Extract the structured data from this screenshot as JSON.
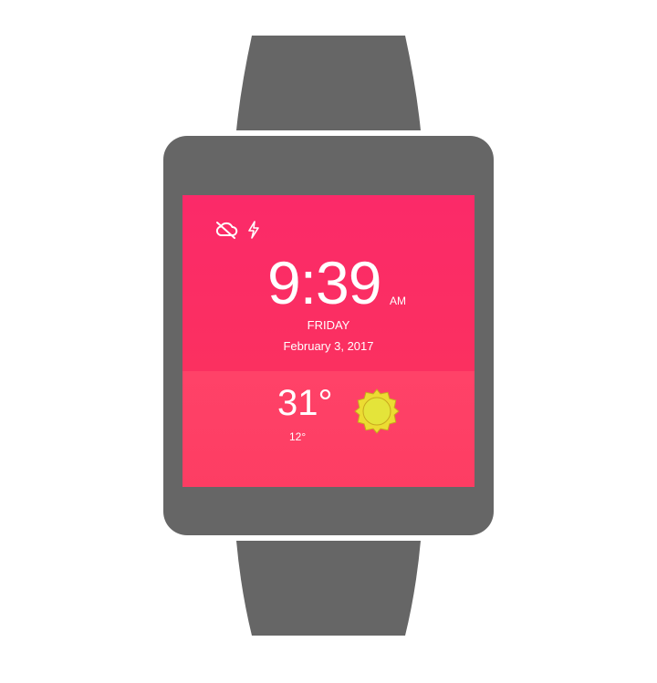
{
  "watch": {
    "case_color": "#666666",
    "accent_top": "#fb2a69",
    "accent_bottom": "#ff4268"
  },
  "status_icons": [
    "cloud-off-icon",
    "bolt-icon"
  ],
  "clock": {
    "time": "9:39",
    "ampm": "AM",
    "day": "FRIDAY",
    "date": "February 3, 2017"
  },
  "weather": {
    "temperature": "31°",
    "low": "12°",
    "condition_icon": "sun-icon"
  }
}
